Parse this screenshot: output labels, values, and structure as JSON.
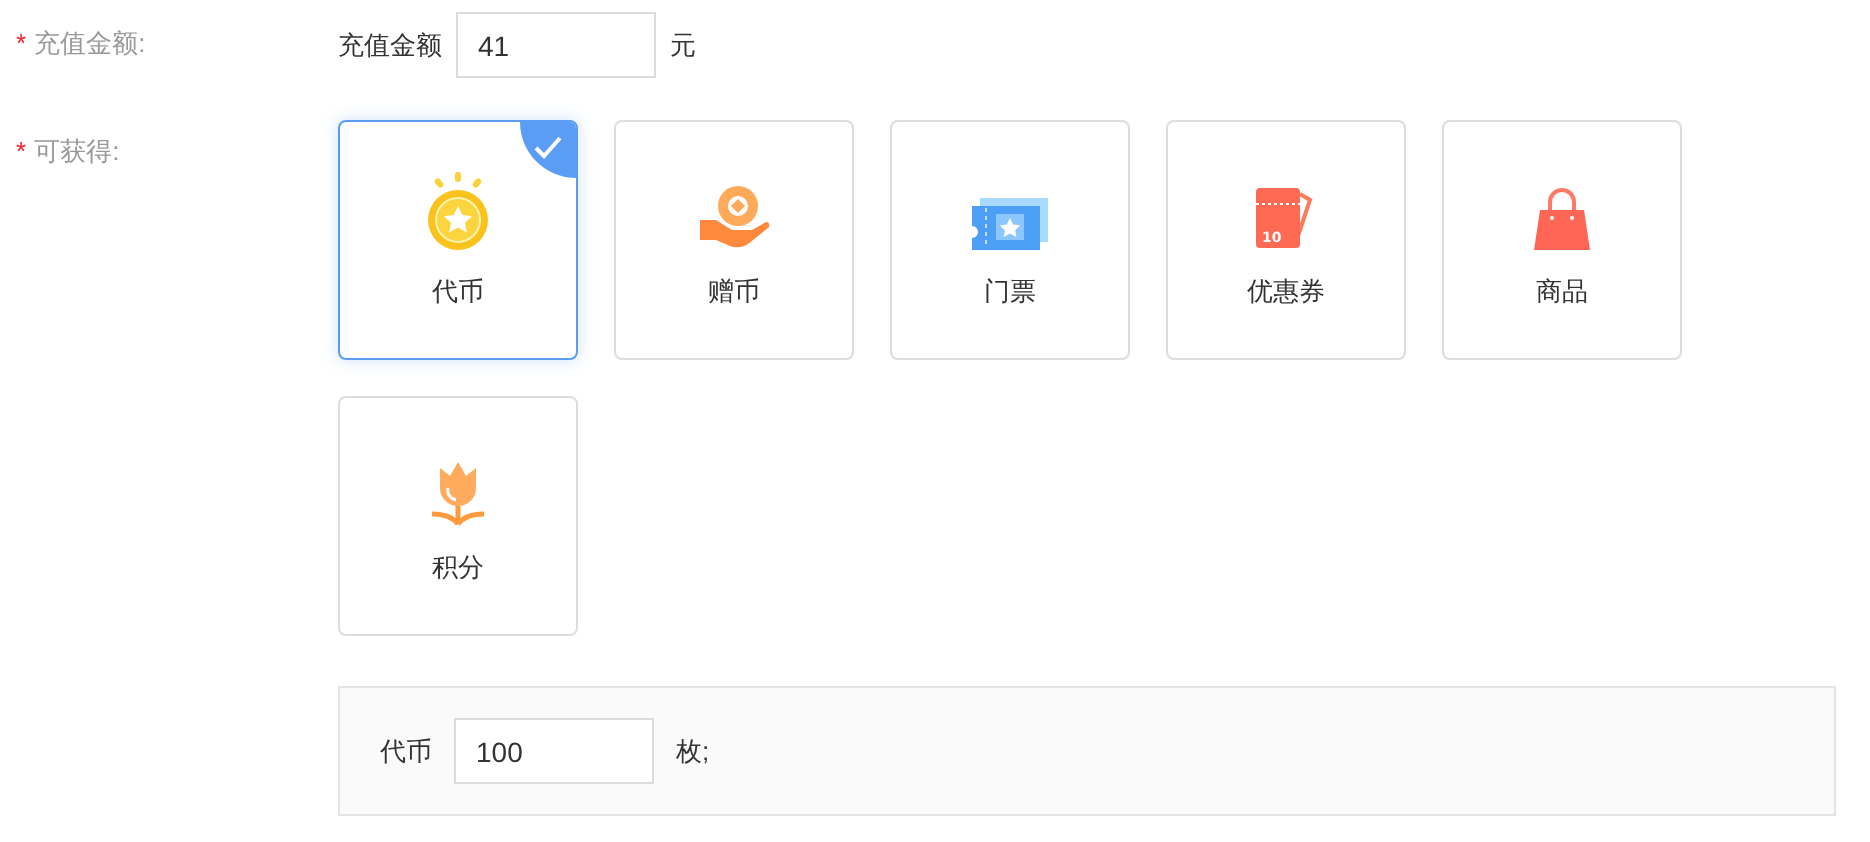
{
  "recharge": {
    "required_mark": "*",
    "label": "充值金额:",
    "field_label": "充值金额",
    "value": "41",
    "unit": "元"
  },
  "obtainable": {
    "required_mark": "*",
    "label": "可获得:",
    "options": [
      {
        "kind": "coin",
        "label": "代币",
        "selected": true
      },
      {
        "kind": "gift",
        "label": "赠币",
        "selected": false
      },
      {
        "kind": "ticket",
        "label": "门票",
        "selected": false
      },
      {
        "kind": "coupon",
        "label": "优惠券",
        "selected": false,
        "icon_text": "10"
      },
      {
        "kind": "bag",
        "label": "商品",
        "selected": false
      },
      {
        "kind": "flower",
        "label": "积分",
        "selected": false
      }
    ]
  },
  "detail": {
    "label": "代币",
    "value": "100",
    "unit": "枚;"
  }
}
